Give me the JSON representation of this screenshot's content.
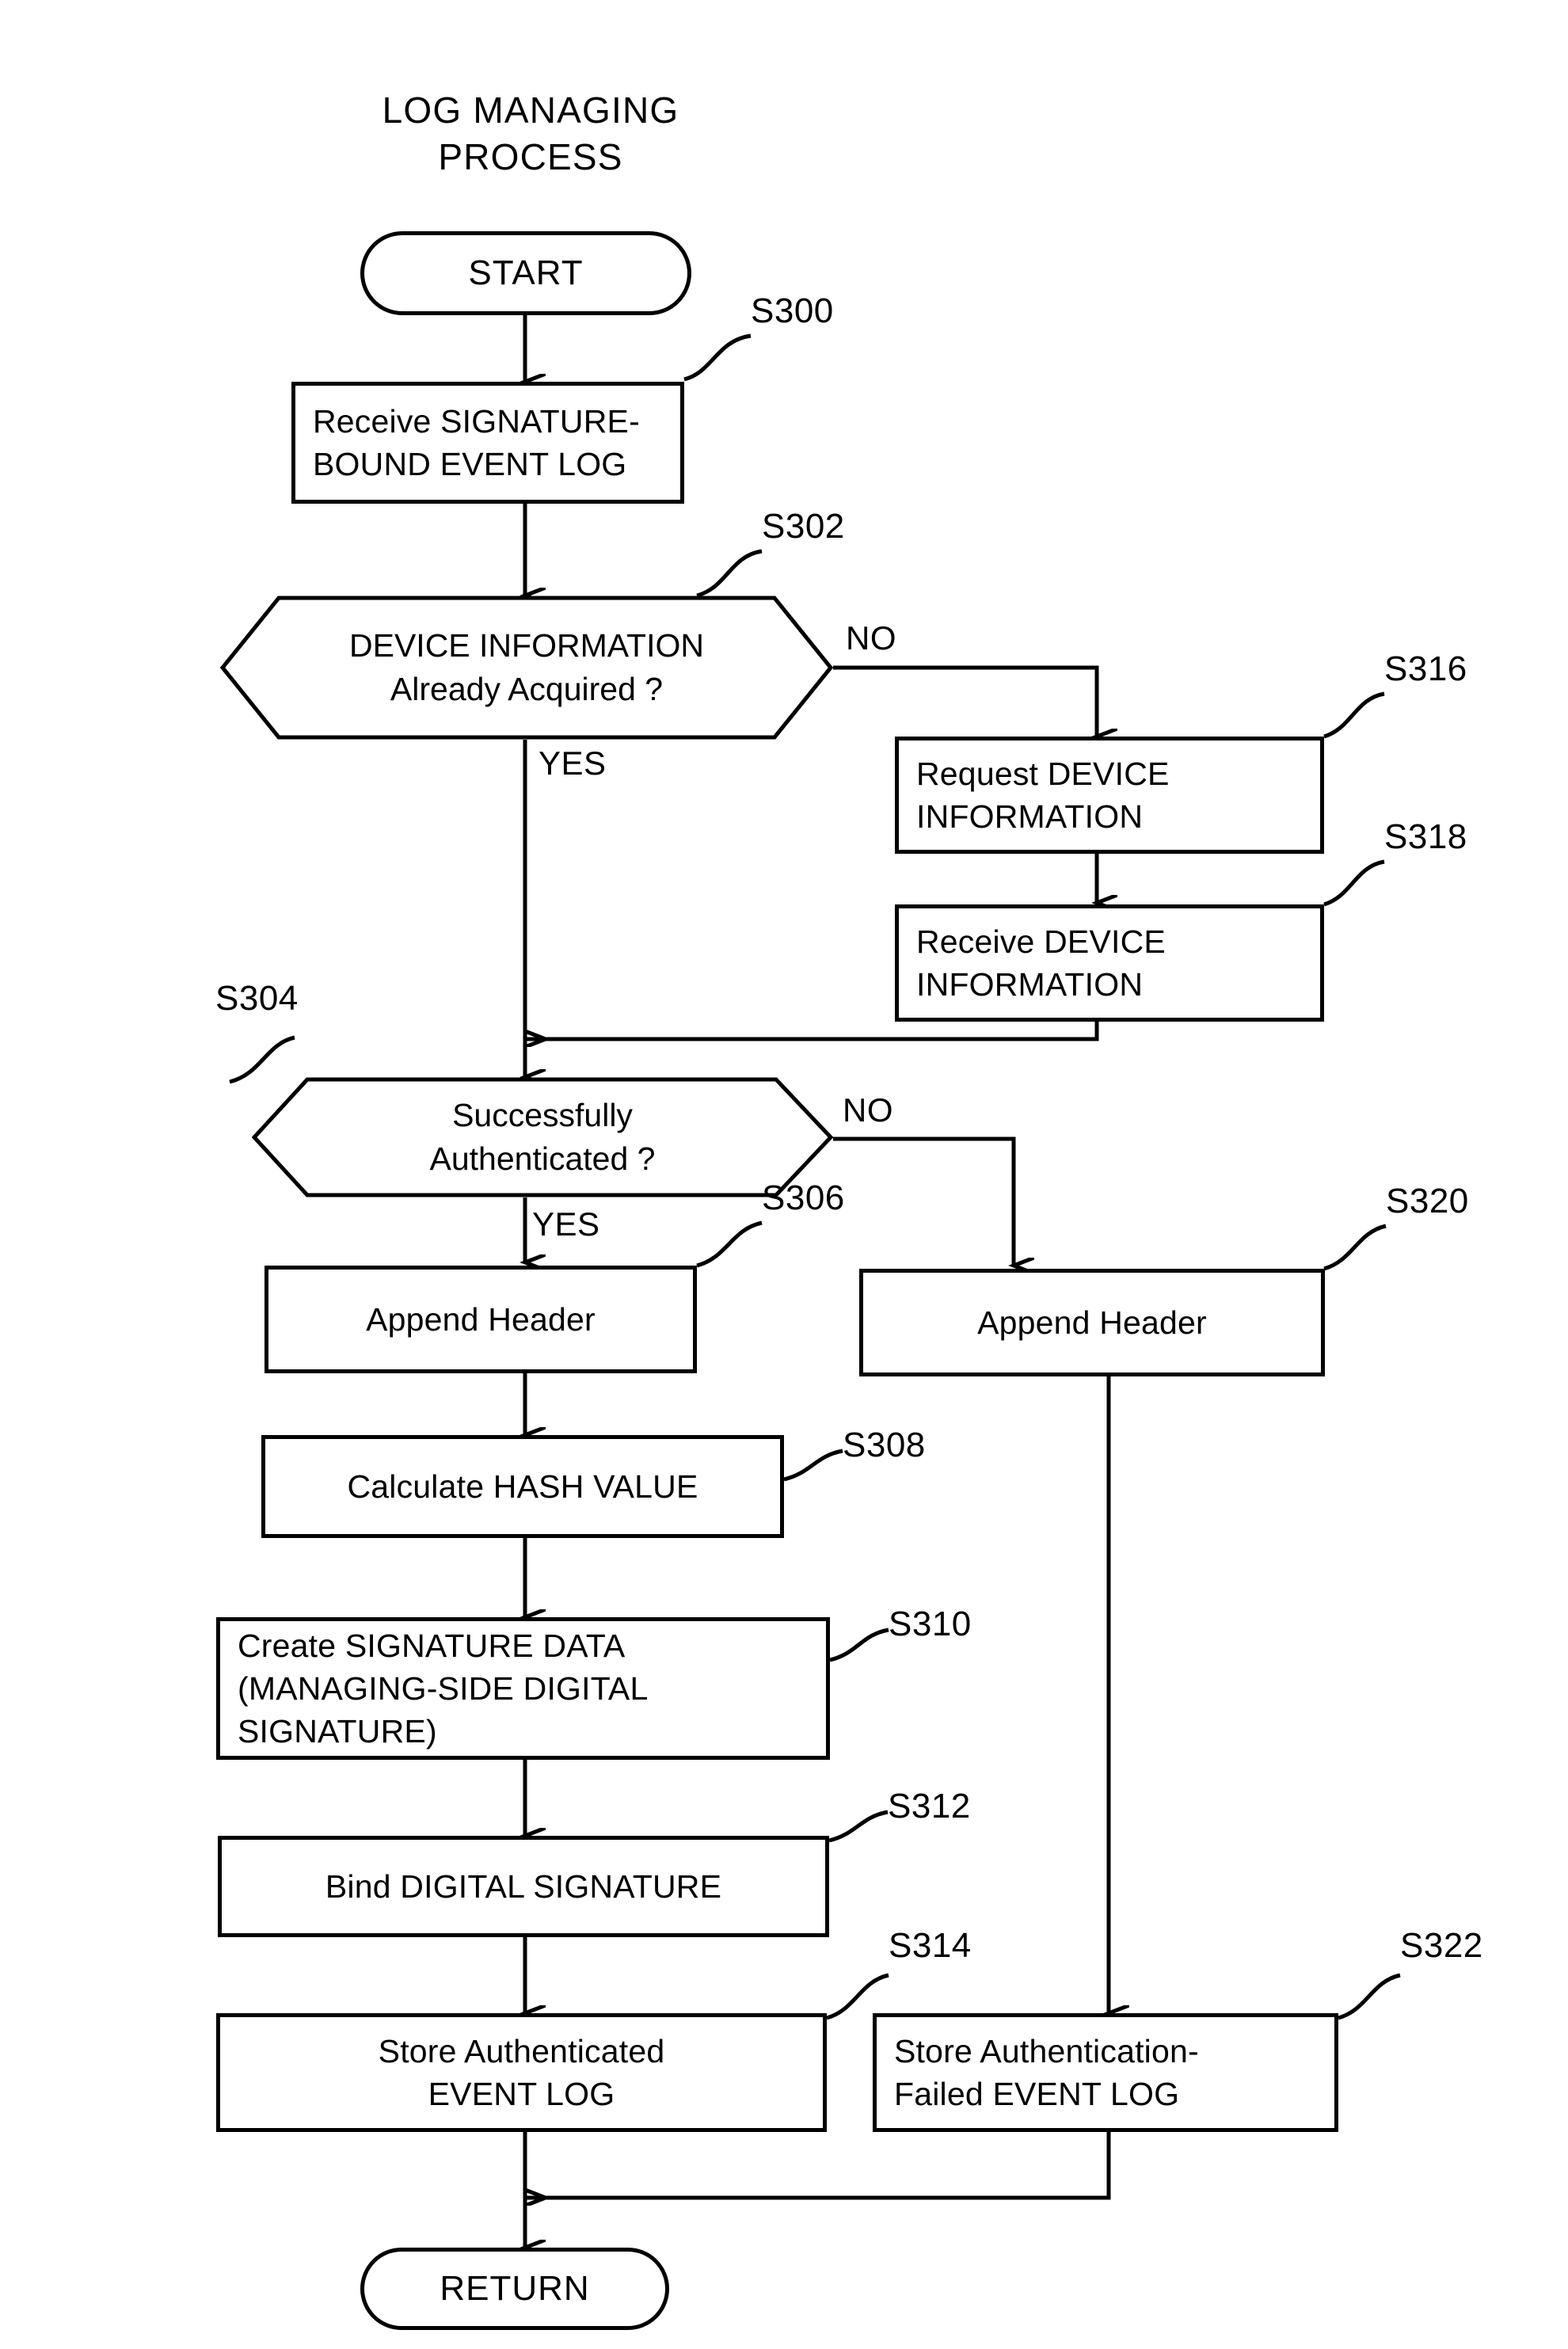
{
  "diagram": {
    "title": "LOG MANAGING\nPROCESS",
    "terminators": {
      "start": "START",
      "return": "RETURN"
    },
    "branch_labels": {
      "device_info_no": "NO",
      "device_info_yes": "YES",
      "auth_no": "NO",
      "auth_yes": "YES"
    },
    "steps": [
      {
        "id": "S300",
        "ref": "S300",
        "shape": "process",
        "text": "Receive SIGNATURE-\nBOUND EVENT LOG"
      },
      {
        "id": "S302",
        "ref": "S302",
        "shape": "decision",
        "line1": "DEVICE INFORMATION",
        "line2": "Already Acquired ?"
      },
      {
        "id": "S316",
        "ref": "S316",
        "shape": "process",
        "text": "Request DEVICE\nINFORMATION"
      },
      {
        "id": "S318",
        "ref": "S318",
        "shape": "process",
        "text": "Receive DEVICE\nINFORMATION"
      },
      {
        "id": "S304",
        "ref": "S304",
        "shape": "decision",
        "line1": "Successfully",
        "line2": "Authenticated ?"
      },
      {
        "id": "S306",
        "ref": "S306",
        "shape": "process",
        "text": "Append Header"
      },
      {
        "id": "S320",
        "ref": "S320",
        "shape": "process",
        "text": "Append Header"
      },
      {
        "id": "S308",
        "ref": "S308",
        "shape": "process",
        "text": "Calculate HASH VALUE"
      },
      {
        "id": "S310",
        "ref": "S310",
        "shape": "process",
        "text": "Create SIGNATURE DATA\n(MANAGING-SIDE DIGITAL\nSIGNATURE)"
      },
      {
        "id": "S312",
        "ref": "S312",
        "shape": "process",
        "text": "Bind DIGITAL SIGNATURE"
      },
      {
        "id": "S314",
        "ref": "S314",
        "shape": "process",
        "text": "Store Authenticated\nEVENT LOG"
      },
      {
        "id": "S322",
        "ref": "S322",
        "shape": "process",
        "text": "Store Authentication-\nFailed EVENT LOG"
      }
    ],
    "colors": {
      "stroke": "#000000",
      "background": "#ffffff"
    }
  }
}
